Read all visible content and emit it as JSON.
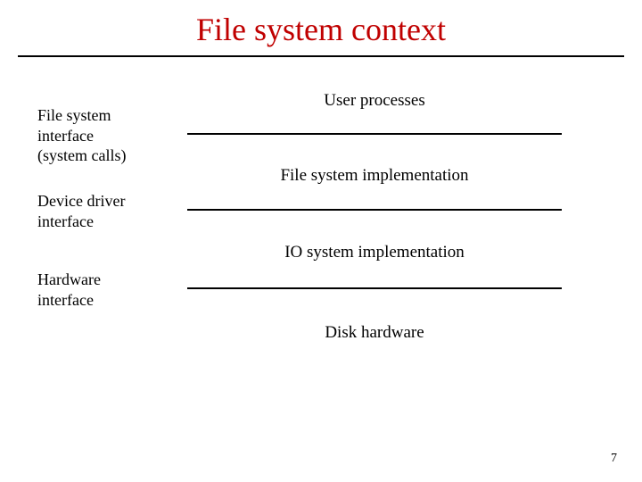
{
  "title": "File system context",
  "left_labels": {
    "fs_interface": "File system\ninterface\n(system calls)",
    "device_driver": "Device driver\ninterface",
    "hardware": "Hardware\ninterface"
  },
  "layers": {
    "user_processes": "User processes",
    "fs_impl": "File system implementation",
    "io_impl": "IO system implementation",
    "disk_hw": "Disk hardware"
  },
  "page_number": "7"
}
